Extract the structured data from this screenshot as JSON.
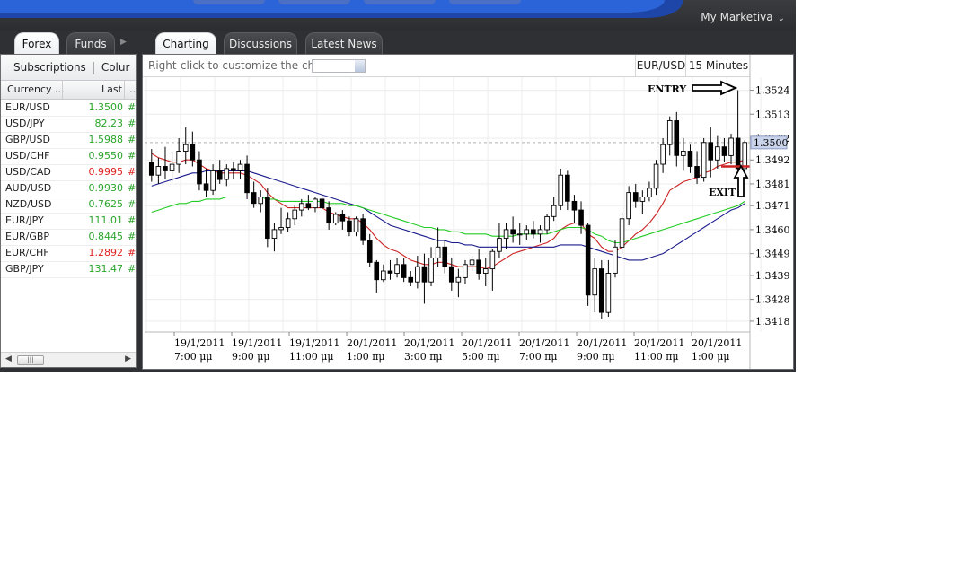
{
  "topbar": {
    "account_menu": "My Marketiva"
  },
  "left_tabs": [
    {
      "label": "Forex",
      "active": true
    },
    {
      "label": "Funds",
      "active": false
    }
  ],
  "right_tabs": [
    {
      "label": "Charting",
      "active": true
    },
    {
      "label": "Discussions",
      "active": false
    },
    {
      "label": "Latest News",
      "active": false
    }
  ],
  "left_toolbar": {
    "subscriptions": "Subscriptions",
    "columns": "Colur"
  },
  "quotes": {
    "headers": {
      "currency": "Currency ...",
      "last": "Last",
      "more": ".."
    },
    "rows": [
      {
        "pair": "EUR/USD",
        "last": "1.3500",
        "dir": "up",
        "trunc": "#"
      },
      {
        "pair": "USD/JPY",
        "last": "82.23",
        "dir": "up",
        "trunc": "#"
      },
      {
        "pair": "GBP/USD",
        "last": "1.5988",
        "dir": "up",
        "trunc": "#"
      },
      {
        "pair": "USD/CHF",
        "last": "0.9550",
        "dir": "up",
        "trunc": "#"
      },
      {
        "pair": "USD/CAD",
        "last": "0.9995",
        "dir": "down",
        "trunc": "#"
      },
      {
        "pair": "AUD/USD",
        "last": "0.9930",
        "dir": "up",
        "trunc": "#"
      },
      {
        "pair": "NZD/USD",
        "last": "0.7625",
        "dir": "up",
        "trunc": "#"
      },
      {
        "pair": "EUR/JPY",
        "last": "111.01",
        "dir": "up",
        "trunc": "#"
      },
      {
        "pair": "EUR/GBP",
        "last": "0.8445",
        "dir": "up",
        "trunc": "#"
      },
      {
        "pair": "EUR/CHF",
        "last": "1.2892",
        "dir": "down",
        "trunc": "#"
      },
      {
        "pair": "GBP/JPY",
        "last": "131.47",
        "dir": "up",
        "trunc": "#"
      }
    ]
  },
  "chart": {
    "hint": "Right-click to customize the chart",
    "symbol": "EUR/USD",
    "timeframe": "15 Minutes",
    "annotations": {
      "entry": "ENTRY",
      "exit": "EXIT"
    },
    "current_price": "1.3500"
  },
  "chart_data": {
    "type": "candlestick",
    "symbol": "EUR/USD",
    "timeframe": "15 Minutes",
    "ylim": [
      1.3413,
      1.353
    ],
    "y_ticks": [
      "1.3524",
      "1.3513",
      "1.3502",
      "1.3492",
      "1.3481",
      "1.3471",
      "1.3460",
      "1.3449",
      "1.3439",
      "1.3428",
      "1.3418"
    ],
    "x_ticks": [
      {
        "date": "19/1/2011",
        "time": "7:00 μμ"
      },
      {
        "date": "19/1/2011",
        "time": "9:00 μμ"
      },
      {
        "date": "19/1/2011",
        "time": "11:00 μμ"
      },
      {
        "date": "20/1/2011",
        "time": "1:00 πμ"
      },
      {
        "date": "20/1/2011",
        "time": "3:00 πμ"
      },
      {
        "date": "20/1/2011",
        "time": "5:00 πμ"
      },
      {
        "date": "20/1/2011",
        "time": "7:00 πμ"
      },
      {
        "date": "20/1/2011",
        "time": "9:00 πμ"
      },
      {
        "date": "20/1/2011",
        "time": "11:00 πμ"
      },
      {
        "date": "20/1/2011",
        "time": "1:00 μμ"
      }
    ],
    "candles_ohlc": [
      [
        1.3491,
        1.3497,
        1.3482,
        1.3485
      ],
      [
        1.3485,
        1.3493,
        1.3481,
        1.3489
      ],
      [
        1.3489,
        1.3498,
        1.3483,
        1.3487
      ],
      [
        1.3487,
        1.3496,
        1.3482,
        1.349
      ],
      [
        1.349,
        1.3502,
        1.3486,
        1.3496
      ],
      [
        1.3496,
        1.3507,
        1.349,
        1.3499
      ],
      [
        1.3499,
        1.3505,
        1.3489,
        1.3492
      ],
      [
        1.3492,
        1.3496,
        1.3478,
        1.3481
      ],
      [
        1.3481,
        1.3488,
        1.3475,
        1.3478
      ],
      [
        1.3478,
        1.349,
        1.3476,
        1.3487
      ],
      [
        1.3487,
        1.3492,
        1.3481,
        1.3483
      ],
      [
        1.3483,
        1.349,
        1.348,
        1.3488
      ],
      [
        1.3488,
        1.3491,
        1.3483,
        1.3487
      ],
      [
        1.3487,
        1.3492,
        1.3483,
        1.349
      ],
      [
        1.349,
        1.3494,
        1.3474,
        1.3477
      ],
      [
        1.3477,
        1.3482,
        1.347,
        1.3472
      ],
      [
        1.3472,
        1.3478,
        1.3468,
        1.3475
      ],
      [
        1.3475,
        1.3479,
        1.3452,
        1.3456
      ],
      [
        1.3456,
        1.3463,
        1.345,
        1.346
      ],
      [
        1.346,
        1.347,
        1.3458,
        1.3461
      ],
      [
        1.3461,
        1.3468,
        1.3459,
        1.3465
      ],
      [
        1.3465,
        1.3471,
        1.3462,
        1.3469
      ],
      [
        1.3469,
        1.3474,
        1.3466,
        1.3472
      ],
      [
        1.3472,
        1.3476,
        1.3469,
        1.347
      ],
      [
        1.347,
        1.3475,
        1.3468,
        1.3474
      ],
      [
        1.3474,
        1.3476,
        1.3469,
        1.347
      ],
      [
        1.347,
        1.3473,
        1.346,
        1.3463
      ],
      [
        1.3463,
        1.3468,
        1.3462,
        1.3467
      ],
      [
        1.3467,
        1.3469,
        1.346,
        1.3464
      ],
      [
        1.3464,
        1.3466,
        1.3457,
        1.3459
      ],
      [
        1.3459,
        1.3466,
        1.3457,
        1.3465
      ],
      [
        1.3465,
        1.3467,
        1.3453,
        1.3455
      ],
      [
        1.3455,
        1.3458,
        1.3443,
        1.3445
      ],
      [
        1.3445,
        1.3446,
        1.3431,
        1.3437
      ],
      [
        1.3437,
        1.3444,
        1.3436,
        1.3441
      ],
      [
        1.3441,
        1.3446,
        1.3437,
        1.344
      ],
      [
        1.344,
        1.3447,
        1.3438,
        1.3444
      ],
      [
        1.3444,
        1.3447,
        1.3436,
        1.3438
      ],
      [
        1.3438,
        1.3441,
        1.3434,
        1.3436
      ],
      [
        1.3436,
        1.3448,
        1.3433,
        1.3443
      ],
      [
        1.3443,
        1.3449,
        1.3426,
        1.3436
      ],
      [
        1.3436,
        1.3452,
        1.3434,
        1.3447
      ],
      [
        1.3447,
        1.3461,
        1.3443,
        1.3452
      ],
      [
        1.3452,
        1.3455,
        1.344,
        1.3443
      ],
      [
        1.3443,
        1.3447,
        1.3432,
        1.3436
      ],
      [
        1.3436,
        1.3442,
        1.3429,
        1.3438
      ],
      [
        1.3438,
        1.3446,
        1.3435,
        1.3444
      ],
      [
        1.3444,
        1.3448,
        1.3441,
        1.3446
      ],
      [
        1.3446,
        1.3451,
        1.3437,
        1.344
      ],
      [
        1.344,
        1.3447,
        1.3434,
        1.3442
      ],
      [
        1.3442,
        1.3451,
        1.3432,
        1.345
      ],
      [
        1.345,
        1.3463,
        1.3447,
        1.3456
      ],
      [
        1.3456,
        1.3463,
        1.3451,
        1.346
      ],
      [
        1.346,
        1.3466,
        1.3454,
        1.3458
      ],
      [
        1.3458,
        1.3463,
        1.3453,
        1.3458
      ],
      [
        1.3458,
        1.3462,
        1.3455,
        1.346
      ],
      [
        1.346,
        1.3464,
        1.3456,
        1.3458
      ],
      [
        1.3458,
        1.3462,
        1.3454,
        1.346
      ],
      [
        1.346,
        1.3467,
        1.3458,
        1.3466
      ],
      [
        1.3466,
        1.3475,
        1.3464,
        1.3471
      ],
      [
        1.3471,
        1.3488,
        1.3469,
        1.3485
      ],
      [
        1.3485,
        1.3487,
        1.3469,
        1.3473
      ],
      [
        1.3473,
        1.3476,
        1.3463,
        1.3469
      ],
      [
        1.3469,
        1.3473,
        1.3458,
        1.3462
      ],
      [
        1.3462,
        1.3463,
        1.3425,
        1.343
      ],
      [
        1.343,
        1.3447,
        1.3422,
        1.3442
      ],
      [
        1.3442,
        1.3446,
        1.3419,
        1.3422
      ],
      [
        1.3422,
        1.3446,
        1.342,
        1.344
      ],
      [
        1.344,
        1.3455,
        1.3438,
        1.3452
      ],
      [
        1.3452,
        1.3468,
        1.3449,
        1.3465
      ],
      [
        1.3465,
        1.348,
        1.3462,
        1.3477
      ],
      [
        1.3477,
        1.3481,
        1.347,
        1.3473
      ],
      [
        1.3473,
        1.3478,
        1.3467,
        1.3475
      ],
      [
        1.3475,
        1.3482,
        1.3473,
        1.3479
      ],
      [
        1.3479,
        1.3492,
        1.3476,
        1.349
      ],
      [
        1.349,
        1.3502,
        1.3486,
        1.3499
      ],
      [
        1.3499,
        1.3512,
        1.3494,
        1.351
      ],
      [
        1.351,
        1.3514,
        1.3489,
        1.3494
      ],
      [
        1.3494,
        1.3502,
        1.3487,
        1.3496
      ],
      [
        1.3496,
        1.3499,
        1.3486,
        1.3489
      ],
      [
        1.3489,
        1.3496,
        1.3481,
        1.3484
      ],
      [
        1.3484,
        1.3502,
        1.3482,
        1.35
      ],
      [
        1.35,
        1.3507,
        1.3484,
        1.3492
      ],
      [
        1.3492,
        1.3503,
        1.3488,
        1.3498
      ],
      [
        1.3498,
        1.3502,
        1.3491,
        1.3494
      ],
      [
        1.3494,
        1.3504,
        1.349,
        1.3502
      ],
      [
        1.3502,
        1.3524,
        1.3487,
        1.3488
      ],
      [
        1.3488,
        1.3501,
        1.3486,
        1.35
      ]
    ],
    "series": [
      {
        "type": "moving_average",
        "color": "#cc2222",
        "values": [
          1.3495,
          1.3493,
          1.3492,
          1.3491,
          1.3491,
          1.3492,
          1.3492,
          1.349,
          1.3488,
          1.3487,
          1.3486,
          1.3486,
          1.3486,
          1.3486,
          1.3485,
          1.3483,
          1.3481,
          1.3477,
          1.3474,
          1.3472,
          1.347,
          1.347,
          1.347,
          1.347,
          1.347,
          1.347,
          1.3468,
          1.3467,
          1.3466,
          1.3465,
          1.3465,
          1.3463,
          1.346,
          1.3456,
          1.3453,
          1.3451,
          1.345,
          1.3448,
          1.3446,
          1.3445,
          1.3444,
          1.3444,
          1.3445,
          1.3445,
          1.3444,
          1.3443,
          1.3443,
          1.3443,
          1.3443,
          1.3442,
          1.3443,
          1.3445,
          1.3447,
          1.3449,
          1.345,
          1.3451,
          1.3452,
          1.3453,
          1.3454,
          1.3456,
          1.346,
          1.3462,
          1.3463,
          1.3463,
          1.3458,
          1.3456,
          1.3452,
          1.345,
          1.345,
          1.3452,
          1.3455,
          1.3458,
          1.346,
          1.3463,
          1.3467,
          1.3472,
          1.3478,
          1.348,
          1.3482,
          1.3483,
          1.3484,
          1.3486,
          1.3487,
          1.3489,
          1.349,
          1.3491,
          1.3491,
          1.3492
        ]
      },
      {
        "type": "moving_average",
        "color": "#1a1a8c",
        "values": [
          1.348,
          1.3481,
          1.3482,
          1.3483,
          1.3484,
          1.3485,
          1.3486,
          1.3486,
          1.3487,
          1.3487,
          1.3487,
          1.3487,
          1.3487,
          1.3487,
          1.3487,
          1.3486,
          1.3485,
          1.3484,
          1.3483,
          1.3482,
          1.3481,
          1.348,
          1.3479,
          1.3478,
          1.3477,
          1.3476,
          1.3475,
          1.3474,
          1.3473,
          1.3472,
          1.3471,
          1.347,
          1.3468,
          1.3466,
          1.3464,
          1.3462,
          1.3461,
          1.346,
          1.3459,
          1.3458,
          1.3457,
          1.3456,
          1.3455,
          1.3455,
          1.3454,
          1.3454,
          1.3453,
          1.3453,
          1.3452,
          1.3452,
          1.3452,
          1.3452,
          1.3452,
          1.3452,
          1.3452,
          1.3452,
          1.3452,
          1.3452,
          1.3452,
          1.3452,
          1.3453,
          1.3453,
          1.3453,
          1.3453,
          1.3452,
          1.3451,
          1.345,
          1.3449,
          1.3448,
          1.3447,
          1.3446,
          1.3446,
          1.3446,
          1.3447,
          1.3448,
          1.3449,
          1.3451,
          1.3453,
          1.3455,
          1.3457,
          1.3459,
          1.3461,
          1.3463,
          1.3465,
          1.3467,
          1.3469,
          1.347,
          1.3472
        ]
      },
      {
        "type": "moving_average",
        "color": "#22cc22",
        "values": [
          1.3468,
          1.3469,
          1.347,
          1.3471,
          1.3472,
          1.3472,
          1.3473,
          1.3473,
          1.3474,
          1.3474,
          1.3474,
          1.3475,
          1.3475,
          1.3475,
          1.3475,
          1.3475,
          1.3475,
          1.3474,
          1.3474,
          1.3473,
          1.3473,
          1.3473,
          1.3473,
          1.3473,
          1.3473,
          1.3473,
          1.3472,
          1.3472,
          1.3472,
          1.3471,
          1.3471,
          1.347,
          1.3469,
          1.3468,
          1.3467,
          1.3466,
          1.3465,
          1.3464,
          1.3463,
          1.3462,
          1.3461,
          1.3461,
          1.346,
          1.346,
          1.3459,
          1.3459,
          1.3458,
          1.3458,
          1.3458,
          1.3458,
          1.3457,
          1.3457,
          1.3457,
          1.3457,
          1.3458,
          1.3458,
          1.3458,
          1.3458,
          1.3458,
          1.3459,
          1.346,
          1.3461,
          1.3461,
          1.3461,
          1.346,
          1.3458,
          1.3457,
          1.3455,
          1.3454,
          1.3454,
          1.3455,
          1.3456,
          1.3457,
          1.3458,
          1.3459,
          1.346,
          1.3461,
          1.3462,
          1.3463,
          1.3464,
          1.3465,
          1.3466,
          1.3467,
          1.3468,
          1.3469,
          1.347,
          1.3471,
          1.3473
        ]
      }
    ],
    "grid": true
  }
}
